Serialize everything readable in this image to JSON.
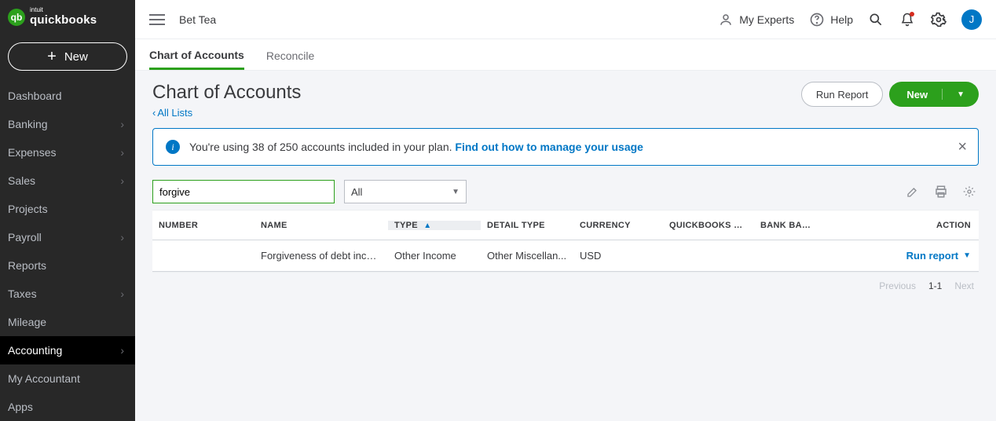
{
  "brand": {
    "name": "quickbooks",
    "small": "intuit",
    "mark": "qb"
  },
  "newButton": "New",
  "avatar": "J",
  "topbar": {
    "menuIcon": "hamburger",
    "company": "Bet Tea",
    "myExperts": "My Experts",
    "help": "Help"
  },
  "sidebar": [
    {
      "label": "Dashboard",
      "chevron": false
    },
    {
      "label": "Banking",
      "chevron": true
    },
    {
      "label": "Expenses",
      "chevron": true
    },
    {
      "label": "Sales",
      "chevron": true
    },
    {
      "label": "Projects",
      "chevron": false
    },
    {
      "label": "Payroll",
      "chevron": true
    },
    {
      "label": "Reports",
      "chevron": false
    },
    {
      "label": "Taxes",
      "chevron": true
    },
    {
      "label": "Mileage",
      "chevron": false
    },
    {
      "label": "Accounting",
      "chevron": true,
      "active": true
    },
    {
      "label": "My Accountant",
      "chevron": false
    },
    {
      "label": "Apps",
      "chevron": false
    }
  ],
  "tabs": [
    {
      "label": "Chart of Accounts",
      "active": true
    },
    {
      "label": "Reconcile",
      "active": false
    }
  ],
  "page": {
    "title": "Chart of Accounts",
    "breadcrumb": "All Lists",
    "runReport": "Run Report",
    "newLabel": "New"
  },
  "banner": {
    "text": "You're using 38 of 250 accounts included in your plan. ",
    "link": "Find out how to manage your usage"
  },
  "filters": {
    "searchValue": "forgive",
    "selectValue": "All"
  },
  "columns": {
    "number": "NUMBER",
    "name": "NAME",
    "type": "TYPE",
    "detail": "DETAIL TYPE",
    "currency": "CURRENCY",
    "qb": "QUICKBOOKS BALANCE",
    "bank": "BANK BALANCE",
    "action": "ACTION"
  },
  "rows": [
    {
      "number": "",
      "name": "Forgiveness of debt income",
      "type": "Other Income",
      "detail": "Other Miscellan...",
      "currency": "USD",
      "qb": "",
      "bank": "",
      "action": "Run report"
    }
  ],
  "pager": {
    "prev": "Previous",
    "range": "1-1",
    "next": "Next"
  }
}
